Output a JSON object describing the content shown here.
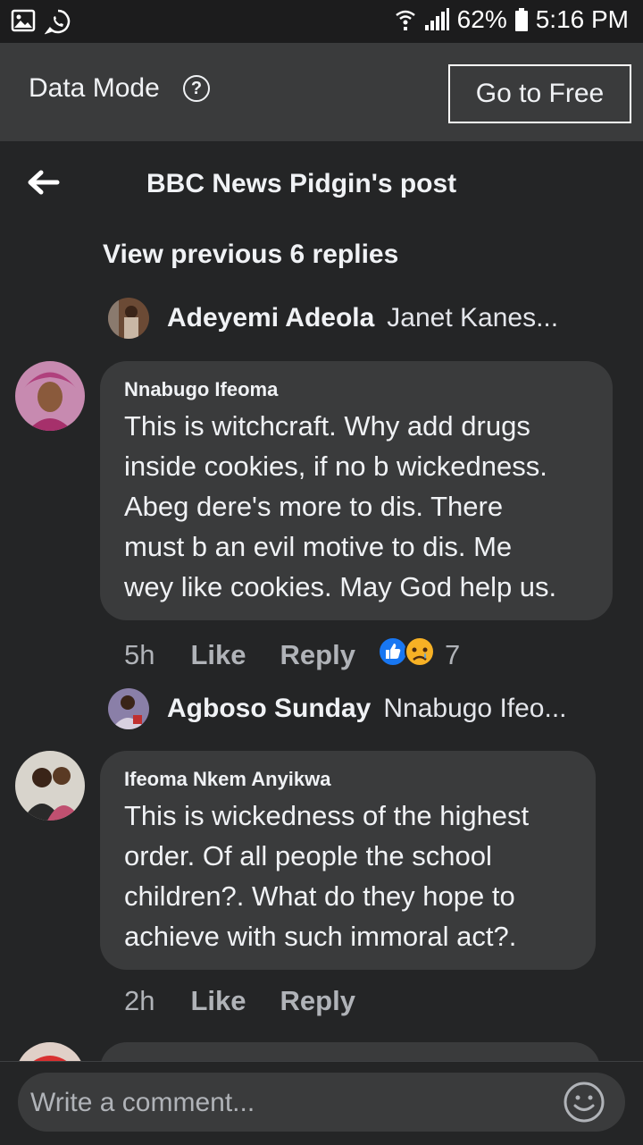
{
  "status_bar": {
    "battery": "62%",
    "time": "5:16 PM"
  },
  "data_mode": {
    "label": "Data Mode",
    "help": "?",
    "go_free": "Go to Free"
  },
  "header": {
    "title": "BBC News Pidgin's post"
  },
  "view_previous": "View previous 6 replies",
  "replies": [
    {
      "name": "Adeyemi Adeola",
      "preview": "Janet Kanes..."
    },
    {
      "name": "Agboso Sunday",
      "preview": "Nnabugo Ifeo..."
    }
  ],
  "comments": [
    {
      "author": "Nnabugo Ifeoma",
      "text": "This is witchcraft. Why add drugs\ninside cookies, if no b wickedness.\nAbeg dere's more to dis. There\nmust b an evil motive to dis. Me\nwey like cookies. May God help us.",
      "time": "5h",
      "like": "Like",
      "reply": "Reply",
      "reaction_count": "7"
    },
    {
      "author": "Ifeoma Nkem Anyikwa",
      "text": "This is wickedness of the highest\norder. Of all people the school\nchildren?. What do they hope to\nachieve with such immoral act?.",
      "time": "2h",
      "like": "Like",
      "reply": "Reply"
    }
  ],
  "composer": {
    "placeholder": "Write a comment..."
  },
  "icons": [
    "gallery-icon",
    "whatsapp-icon",
    "wifi-icon",
    "signal-icon",
    "battery-icon",
    "back-arrow-icon",
    "like-reaction-icon",
    "sad-reaction-icon",
    "emoji-icon"
  ],
  "colors": {
    "background": "#242526",
    "bubble": "#3a3b3c",
    "like_blue": "#1877f2",
    "sad_yellow": "#f7b125"
  }
}
